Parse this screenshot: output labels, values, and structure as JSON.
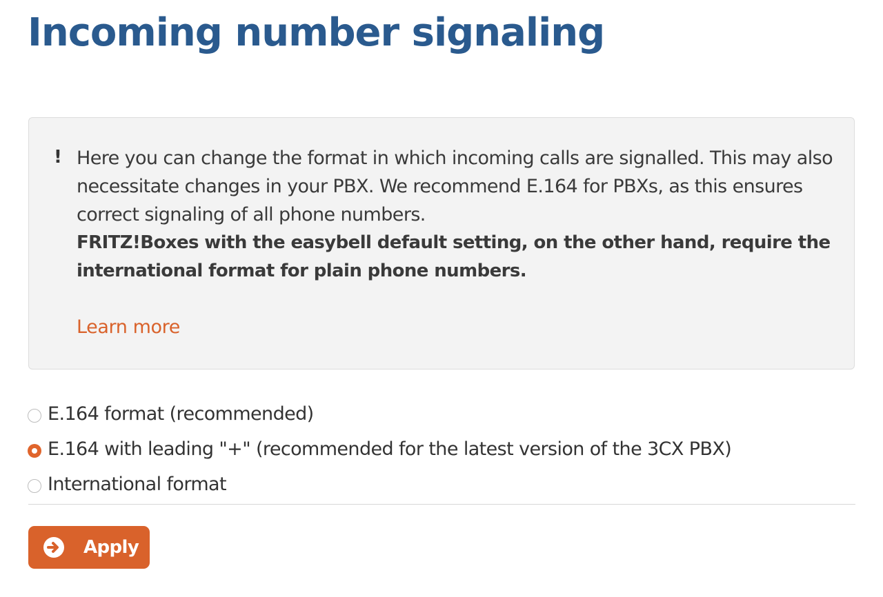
{
  "page": {
    "title": "Incoming number signaling"
  },
  "info": {
    "icon": "exclamation-icon",
    "icon_glyph": "!",
    "text": "Here you can change the format in which incoming calls are signalled. This may also necessitate changes in your PBX. We recommend E.164 for PBXs, as this ensures correct signaling of all phone numbers.",
    "bold_text": "FRITZ!Boxes with the easybell default setting, on the other hand, require the international format for plain phone numbers.",
    "learn_more_label": "Learn more"
  },
  "format_options": [
    {
      "label": "E.164 format (recommended)",
      "selected": false
    },
    {
      "label": "E.164 with leading \"+\" (recommended for the latest version of the 3CX PBX)",
      "selected": true
    },
    {
      "label": "International format",
      "selected": false
    }
  ],
  "apply_button": {
    "label": "Apply",
    "icon": "arrow-right-circle-icon"
  },
  "colors": {
    "title": "#2a5a8e",
    "accent": "#d9622b",
    "info_background": "#f3f3f3"
  }
}
